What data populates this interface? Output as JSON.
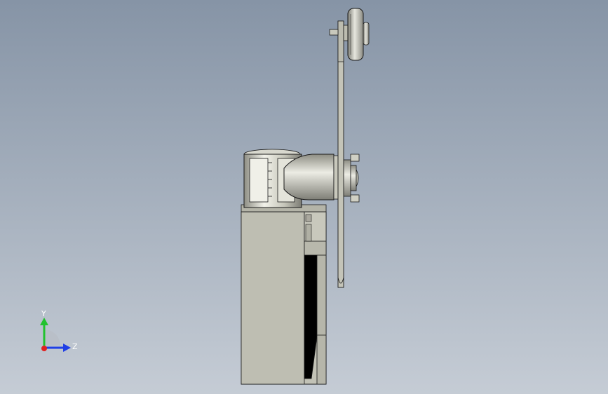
{
  "viewport": {
    "background_top": "#8694a6",
    "background_bottom": "#c5ccd5"
  },
  "model": {
    "part_fill": "#c2c2b6",
    "part_shade": "#9c9c92",
    "edge_color": "#1a1a1a"
  },
  "triad": {
    "y_label": "Y",
    "z_label": "Z",
    "y_color": "#22c22e",
    "z_color": "#1f3fe6",
    "x_color": "#e02020"
  }
}
